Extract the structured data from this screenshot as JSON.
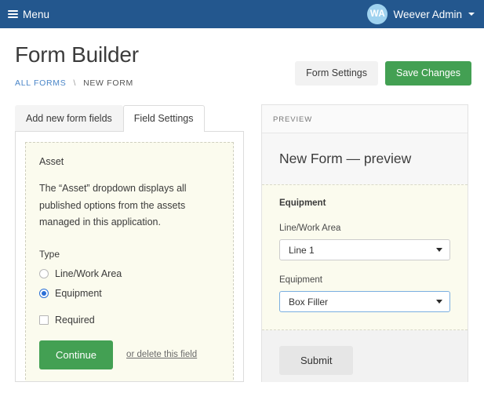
{
  "navbar": {
    "menu_label": "Menu",
    "menu_icon": "hamburger-icon",
    "avatar_initials": "WA",
    "user_name": "Weever Admin",
    "caret_icon": "chevron-down-icon",
    "background_color": "#23578e",
    "avatar_color": "#9fd2ef"
  },
  "header": {
    "title": "Form Builder",
    "breadcrumb": {
      "root_label": "ALL FORMS",
      "separator": "\\",
      "current_label": "NEW FORM",
      "link_color": "#4a86c8"
    },
    "actions": {
      "form_settings_label": "Form Settings",
      "save_changes_label": "Save Changes",
      "save_color": "#43a053"
    }
  },
  "left_panel": {
    "tabs": [
      {
        "label": "Add new form fields",
        "active": false
      },
      {
        "label": "Field Settings",
        "active": true
      }
    ],
    "field_card": {
      "title": "Asset",
      "description": "The “Asset” dropdown displays all published options from the assets managed in this application.",
      "type_label": "Type",
      "radios": [
        {
          "label": "Line/Work Area",
          "checked": false
        },
        {
          "label": "Equipment",
          "checked": true
        }
      ],
      "checkbox": {
        "label": "Required",
        "checked": false
      },
      "continue_label": "Continue",
      "delete_label": "or delete this field",
      "accent_color": "#2a6fd6",
      "background_color": "#fbfbee"
    }
  },
  "preview_panel": {
    "header_label": "PREVIEW",
    "form_title": "New Form — preview",
    "form": {
      "heading": "Equipment",
      "fields": [
        {
          "label": "Line/Work Area",
          "value": "Line 1",
          "focused": false
        },
        {
          "label": "Equipment",
          "value": "Box Filler",
          "focused": true
        }
      ]
    },
    "submit_label": "Submit"
  }
}
